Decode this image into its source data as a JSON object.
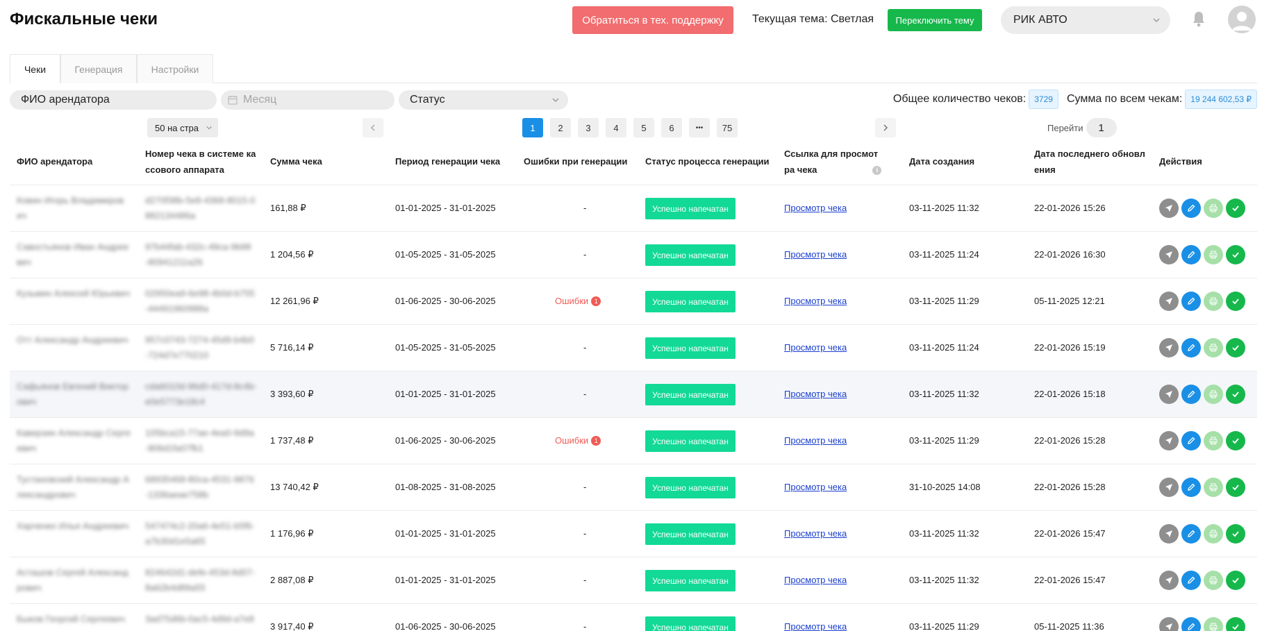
{
  "header": {
    "title": "Фискальные чеки",
    "support_label": "Обратиться в тех. поддержку",
    "theme_text": "Текущая тема: Светлая",
    "switch_theme_label": "Переключить тему",
    "org_name": "РИК АВТО"
  },
  "tabs": [
    {
      "label": "Чеки",
      "active": true
    },
    {
      "label": "Генерация",
      "active": false
    },
    {
      "label": "Настройки",
      "active": false
    }
  ],
  "filters": {
    "tenant": "ФИО арендатора",
    "month_placeholder": "Месяц",
    "status": "Статус"
  },
  "totals": {
    "count_label": "Общее количество чеков:",
    "count_value": "3729",
    "sum_label": "Сумма по всем чекам:",
    "sum_value": "19 244 602,53 ₽"
  },
  "pagination": {
    "page_size": "50 на стра",
    "pages": [
      "1",
      "2",
      "3",
      "4",
      "5",
      "6",
      "•••",
      "75"
    ],
    "current": "1",
    "goto_label": "Перейти",
    "goto_value": "1"
  },
  "columns": {
    "tenant": "ФИО арендатора",
    "receipt_no_1": "Номер чека в системе ка",
    "receipt_no_2": "ссового аппарата",
    "amount": "Сумма чека",
    "period": "Период генерации чека",
    "errors": "Ошибки при генерации",
    "status": "Статус процесса генерации",
    "link_1": "Ссылка для просмот",
    "link_2": "ра чека",
    "created": "Дата создания",
    "updated_1": "Дата последнего обновл",
    "updated_2": "ения",
    "actions": "Действия"
  },
  "error_label": "Ошибки",
  "rows": [
    {
      "name1": "Ковин Игорь Владимиров",
      "name2": "ич",
      "id1": "d270f38b-5e8-4368-8015-0",
      "id2": "882134486а",
      "amount": "161,88 ₽",
      "period": "01-01-2025 - 31-01-2025",
      "errors": "-",
      "error_count": "",
      "status": "Успешно напечатан",
      "link": "Просмотр чека",
      "created": "03-11-2025 11:32",
      "updated": "22-01-2026 15:26"
    },
    {
      "name1": "Савостьянов Иван Андрее",
      "name2": "вич",
      "id1": "97b44fab-432c-49ca-9b98",
      "id2": "-80941211a26",
      "amount": "1 204,56 ₽",
      "period": "01-05-2025 - 31-05-2025",
      "errors": "-",
      "error_count": "",
      "status": "Успешно напечатан",
      "link": "Просмотр чека",
      "created": "03-11-2025 11:24",
      "updated": "22-01-2026 16:30"
    },
    {
      "name1": "Кузьмин Алексей Юрьевич",
      "name2": "",
      "id1": "02950ea9-6e98-4b0d-b755",
      "id2": "-44491960988а",
      "amount": "12 261,96 ₽",
      "period": "01-06-2025 - 30-06-2025",
      "errors": "Ошибки",
      "error_count": "1",
      "status": "Успешно напечатан",
      "link": "Просмотр чека",
      "created": "03-11-2025 11:29",
      "updated": "05-11-2025 12:21"
    },
    {
      "name1": "Отт Александр Андреевич",
      "name2": "",
      "id1": "957c0743-7274-45d9-b4b0",
      "id2": "-724d7e770210",
      "amount": "5 716,14 ₽",
      "period": "01-05-2025 - 31-05-2025",
      "errors": "-",
      "error_count": "",
      "status": "Успешно напечатан",
      "link": "Просмотр чека",
      "created": "03-11-2025 11:24",
      "updated": "22-01-2026 15:19"
    },
    {
      "name1": "Сафьянов Евгений Виктор",
      "name2": "ович",
      "id1": "cda6010d-96d0-417d-8c4b-",
      "id2": "e0e5773e18c4",
      "amount": "3 393,60 ₽",
      "period": "01-01-2025 - 31-01-2025",
      "errors": "-",
      "error_count": "",
      "status": "Успешно напечатан",
      "link": "Просмотр чека",
      "created": "03-11-2025 11:32",
      "updated": "22-01-2026 15:18"
    },
    {
      "name1": "Каверзин Александр Серге",
      "name2": "евич",
      "id1": "105bca15-77ae-4ea0-9d9a",
      "id2": "-806d1fa07fb1",
      "amount": "1 737,48 ₽",
      "period": "01-06-2025 - 30-06-2025",
      "errors": "Ошибки",
      "error_count": "1",
      "status": "Успешно напечатан",
      "link": "Просмотр чека",
      "created": "03-11-2025 11:29",
      "updated": "22-01-2026 15:28"
    },
    {
      "name1": "Тустановский Александр А",
      "name2": "лександрович",
      "id1": "68935468-80ca-4531-9876",
      "id2": "-1336aeae758b",
      "amount": "13 740,42 ₽",
      "period": "01-08-2025 - 31-08-2025",
      "errors": "-",
      "error_count": "",
      "status": "Успешно напечатан",
      "link": "Просмотр чека",
      "created": "31-10-2025 14:08",
      "updated": "22-01-2026 15:28"
    },
    {
      "name1": "Харченко Илья Андреевич",
      "name2": "",
      "id1": "547474c2-20a6-4e51-b5f6-",
      "id2": "a7b30d1e5a65",
      "amount": "1 176,96 ₽",
      "period": "01-01-2025 - 31-01-2025",
      "errors": "-",
      "error_count": "",
      "status": "Успешно напечатан",
      "link": "Просмотр чека",
      "created": "03-11-2025 11:32",
      "updated": "22-01-2026 15:47"
    },
    {
      "name1": "Асташов Сергей Александ",
      "name2": "рович",
      "id1": "824642d1-defe-453d-8d07-",
      "id2": "8a62b4d89a55",
      "amount": "2 887,08 ₽",
      "period": "01-01-2025 - 31-01-2025",
      "errors": "-",
      "error_count": "",
      "status": "Успешно напечатан",
      "link": "Просмотр чека",
      "created": "03-11-2025 11:32",
      "updated": "22-01-2026 15:47"
    },
    {
      "name1": "Быков Георгий Сергеевич",
      "name2": "",
      "id1": "3ad75d6b-0ac5-4d9d-a7e8",
      "id2": "",
      "amount": "3 917,40 ₽",
      "period": "01-06-2025 - 30-06-2025",
      "errors": "-",
      "error_count": "",
      "status": "Успешно напечатан",
      "link": "Просмотр чека",
      "created": "03-11-2025 11:29",
      "updated": "05-11-2025 11:36"
    }
  ],
  "icons": {
    "org_chevron": "chevron-down-icon",
    "bell": "bell-icon",
    "avatar": "user-avatar-icon",
    "calendar": "calendar-icon",
    "send": "send-icon",
    "edit": "pencil-icon",
    "print": "printer-icon",
    "confirm": "check-icon"
  },
  "colors": {
    "support": "#f26d6f",
    "switch_theme": "#16b84b",
    "status_success": "#12d996",
    "error": "#f05b55",
    "active_page": "#1a8fe6",
    "link": "#1a3fcf"
  }
}
